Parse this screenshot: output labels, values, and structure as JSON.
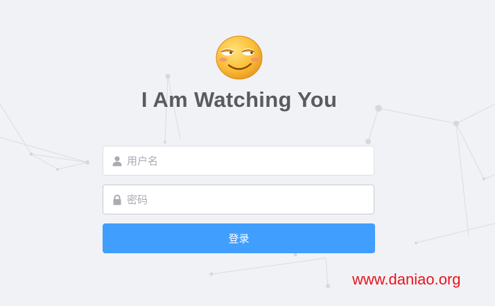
{
  "page": {
    "title": "I Am Watching You",
    "logo_icon": "smirking-emoji-icon"
  },
  "login_form": {
    "username": {
      "placeholder": "用户名",
      "value": "",
      "icon": "user-icon"
    },
    "password": {
      "placeholder": "密码",
      "value": "",
      "icon": "lock-icon"
    },
    "submit_label": "登录"
  },
  "watermark": {
    "text": "www.daniao.org"
  },
  "colors": {
    "background": "#f1f2f6",
    "primary": "#409eff",
    "title": "#5b5b5d",
    "watermark": "#e8141b",
    "input_border": "#dcdfe6"
  }
}
